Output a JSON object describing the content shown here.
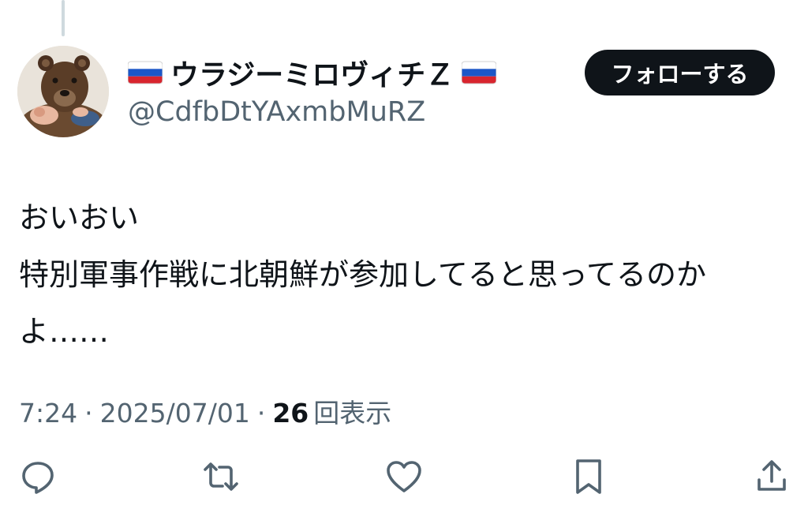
{
  "user": {
    "display_name": "ウラジーミロヴィチＺ",
    "handle": "@CdfbDtYAxmbMuRZ",
    "flag_icon": "russian-flag-icon",
    "avatar": "bear-avatar"
  },
  "follow_button": {
    "label": "フォローする"
  },
  "tweet": {
    "lines": [
      "おいおい",
      "特別軍事作戦に北朝鮮が参加してると思ってるのか",
      "よ……"
    ]
  },
  "meta": {
    "time": "7:24",
    "separator": "·",
    "date": "2025/07/01",
    "views_count": "26",
    "views_label": "回表示"
  },
  "actions": {
    "reply_icon": "reply-icon",
    "retweet_icon": "retweet-icon",
    "like_icon": "heart-icon",
    "bookmark_icon": "bookmark-icon",
    "share_icon": "share-icon"
  },
  "colors": {
    "text_primary": "#0f1419",
    "text_secondary": "#536471",
    "button_bg": "#0f1419",
    "thread_line": "#cfd9de"
  }
}
